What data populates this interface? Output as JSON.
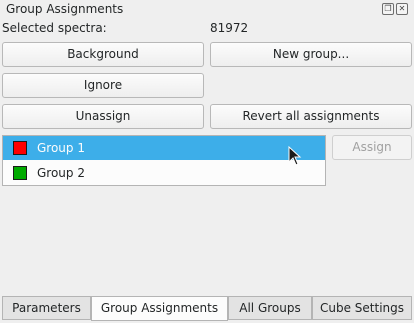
{
  "panel": {
    "title": "Group Assignments",
    "title_buttons": [
      "float-icon",
      "close-icon"
    ]
  },
  "selected": {
    "label": "Selected spectra:",
    "value": "81972"
  },
  "buttons": {
    "background": "Background",
    "new_group": "New group...",
    "ignore": "Ignore",
    "unassign": "Unassign",
    "revert_all": "Revert all assignments",
    "assign": "Assign"
  },
  "groups": [
    {
      "label": "Group 1",
      "color": "#ff0000",
      "selected": true
    },
    {
      "label": "Group 2",
      "color": "#00aa00",
      "selected": false
    }
  ],
  "tabs": [
    {
      "label": "Parameters",
      "active": false
    },
    {
      "label": "Group Assignments",
      "active": true
    },
    {
      "label": "All Groups",
      "active": false
    },
    {
      "label": "Cube Settings",
      "active": false
    }
  ]
}
